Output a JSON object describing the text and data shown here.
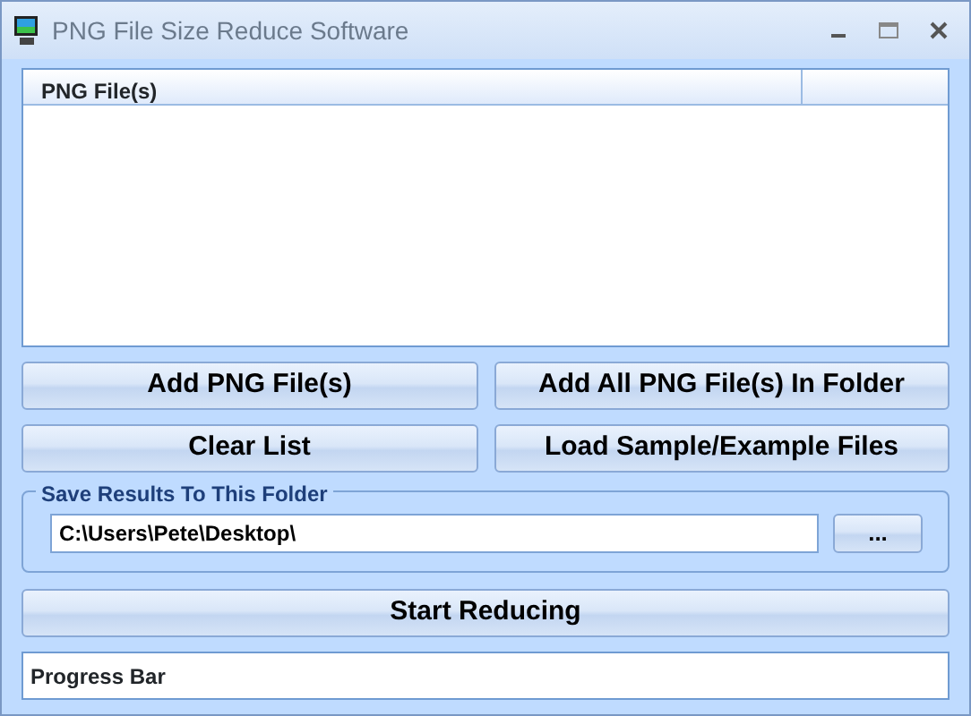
{
  "window": {
    "title": "PNG File Size Reduce Software"
  },
  "file_list": {
    "columns": [
      "PNG File(s)"
    ]
  },
  "buttons": [
    "Add PNG File(s)",
    "Add All PNG File(s) In Folder",
    "Clear List",
    "Load Sample/Example Files"
  ],
  "save_folder": {
    "legend": "Save Results To This Folder",
    "value": "C:\\Users\\Pete\\Desktop\\",
    "browse": "..."
  },
  "start_button": "Start Reducing",
  "progress": {
    "label": "Progress Bar",
    "level": 0
  }
}
